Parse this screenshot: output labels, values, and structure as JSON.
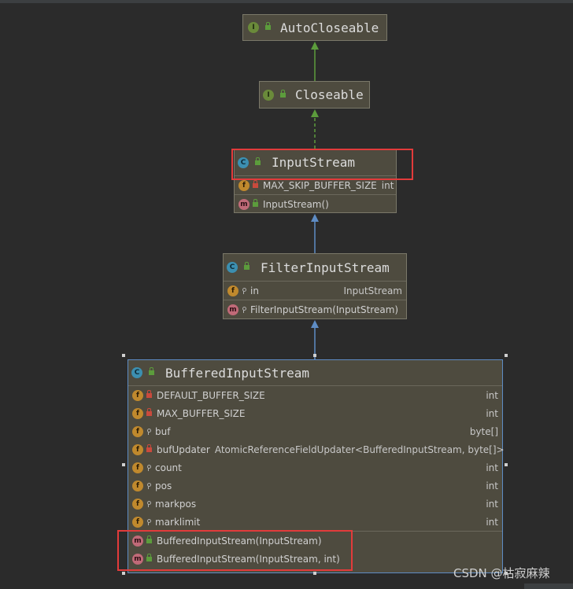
{
  "diagram": {
    "nodes": [
      {
        "id": "autocloseable",
        "kind": "I",
        "name": "AutoCloseable",
        "visibility": "public",
        "sections": []
      },
      {
        "id": "closeable",
        "kind": "I",
        "name": "Closeable",
        "visibility": "public",
        "sections": []
      },
      {
        "id": "inputstream",
        "kind": "C",
        "name": "InputStream",
        "visibility": "public",
        "sections": [
          [
            {
              "kind": "f",
              "vis": "private",
              "name": "MAX_SKIP_BUFFER_SIZE",
              "type": "int",
              "inline_type": true
            }
          ],
          [
            {
              "kind": "m",
              "vis": "public",
              "name": "InputStream()",
              "type": ""
            }
          ]
        ]
      },
      {
        "id": "filterinputstream",
        "kind": "C",
        "name": "FilterInputStream",
        "visibility": "public",
        "sections": [
          [
            {
              "kind": "f",
              "vis": "package",
              "name": "in",
              "type": "InputStream"
            }
          ],
          [
            {
              "kind": "m",
              "vis": "package",
              "name": "FilterInputStream(InputStream)",
              "type": ""
            }
          ]
        ]
      },
      {
        "id": "bufferedinputstream",
        "kind": "C",
        "name": "BufferedInputStream",
        "visibility": "public",
        "sections": [
          [
            {
              "kind": "f",
              "vis": "private",
              "name": "DEFAULT_BUFFER_SIZE",
              "type": "int"
            },
            {
              "kind": "f",
              "vis": "private",
              "name": "MAX_BUFFER_SIZE",
              "type": "int"
            },
            {
              "kind": "f",
              "vis": "package",
              "name": "buf",
              "type": "byte[]"
            },
            {
              "kind": "f",
              "vis": "private",
              "name": "bufUpdater",
              "type": "AtomicReferenceFieldUpdater<BufferedInputStream, byte[]>",
              "inline_type": true
            },
            {
              "kind": "f",
              "vis": "package",
              "name": "count",
              "type": "int"
            },
            {
              "kind": "f",
              "vis": "package",
              "name": "pos",
              "type": "int"
            },
            {
              "kind": "f",
              "vis": "package",
              "name": "markpos",
              "type": "int"
            },
            {
              "kind": "f",
              "vis": "package",
              "name": "marklimit",
              "type": "int"
            }
          ],
          [
            {
              "kind": "m",
              "vis": "public",
              "name": "BufferedInputStream(InputStream)",
              "type": ""
            },
            {
              "kind": "m",
              "vis": "public",
              "name": "BufferedInputStream(InputStream, int)",
              "type": ""
            }
          ]
        ]
      }
    ],
    "edges": [
      {
        "from": "closeable",
        "to": "autocloseable",
        "style": "solid",
        "color": "#5c9c3c"
      },
      {
        "from": "inputstream",
        "to": "closeable",
        "style": "dashed",
        "color": "#5c9c3c"
      },
      {
        "from": "filterinputstream",
        "to": "inputstream",
        "style": "solid",
        "color": "#5e8cc4"
      },
      {
        "from": "bufferedinputstream",
        "to": "filterinputstream",
        "style": "solid",
        "color": "#5e8cc4"
      }
    ],
    "selected": "bufferedinputstream",
    "highlighted": [
      "inputstream-title",
      "bufferedinputstream-constructors"
    ]
  },
  "watermark": "CSDN @枯寂麻辣",
  "colors": {
    "accent_highlight": "#e23b3b",
    "background": "#2b2b2b",
    "node_fill": "#4e4b3f"
  }
}
